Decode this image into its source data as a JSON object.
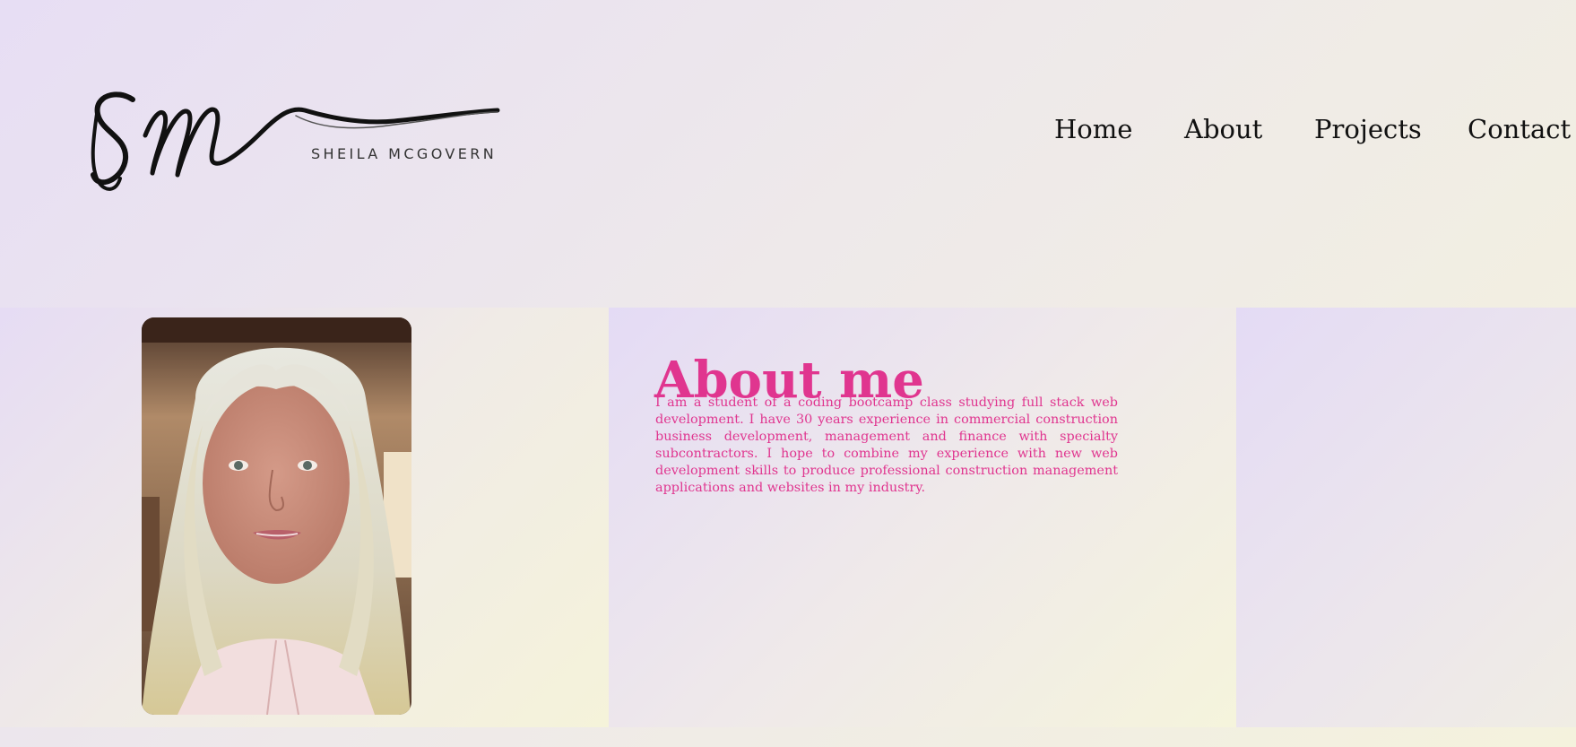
{
  "header": {
    "logo": {
      "monogram": "sm",
      "name": "SHEILA MCGOVERN",
      "icon": "signature-logo"
    },
    "nav": {
      "home": "Home",
      "about": "About",
      "projects": "Projects",
      "contact": "Contact"
    }
  },
  "about": {
    "title": "About me",
    "body": "I am a student of a coding bootcamp class studying full stack web development. I have 30 years experience in commercial construction business development, management and finance with specialty subcontractors. I hope to combine my experience with new web development skills to produce professional construction management applications and websites in my industry.",
    "photo": {
      "icon": "profile-photo"
    }
  },
  "colors": {
    "accent": "#e0358f",
    "nav_text": "#111111",
    "background_start": "#e7def4",
    "background_end": "#f4f2dd"
  }
}
